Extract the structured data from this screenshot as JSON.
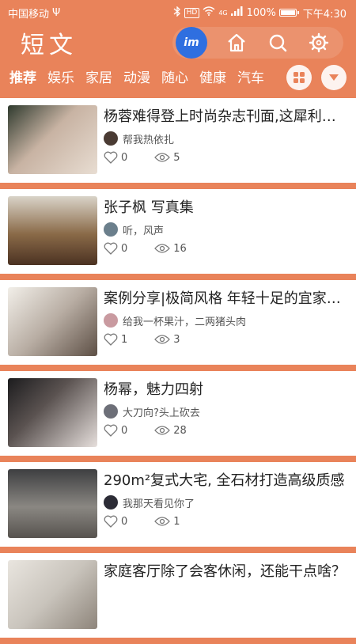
{
  "status_bar": {
    "carrier": "中国移动",
    "usb": "Ψ",
    "hd_tag": "HD",
    "network": "4G",
    "battery": "100%",
    "time": "下午4:30"
  },
  "header": {
    "logo": "短文",
    "app_badge": "im"
  },
  "tabs": [
    "推荐",
    "娱乐",
    "家居",
    "动漫",
    "随心",
    "健康",
    "汽车"
  ],
  "active_tab": 0,
  "articles": [
    {
      "title": "杨蓉难得登上时尚杂志刊面,这犀利眼神...",
      "author": "帮我热依扎",
      "likes": "0",
      "views": "5",
      "thumb": "#b9a79a",
      "avatar": "#4a3b33"
    },
    {
      "title": "张子枫 写真集",
      "author": "听，风声",
      "likes": "0",
      "views": "16",
      "thumb": "#8a6a48",
      "avatar": "#6b7f8c"
    },
    {
      "title": "案例分享|极简风格 年轻十足的宜家设计",
      "author": "给我一杯果汁，二两猪头肉",
      "likes": "1",
      "views": "3",
      "thumb": "#9c8e84",
      "avatar": "#c99aa0"
    },
    {
      "title": "杨幂，魅力四射",
      "author": "大刀向?头上砍去",
      "likes": "0",
      "views": "28",
      "thumb": "#3e3a3a",
      "avatar": "#6d6f78"
    },
    {
      "title": "290m²复式大宅, 全石材打造高级质感",
      "author": "我那天看见你了",
      "likes": "0",
      "views": "1",
      "thumb": "#76736e",
      "avatar": "#2c2c36"
    },
    {
      "title": "家庭客厅除了会客休闲，还能干点啥？",
      "author": "",
      "likes": "",
      "views": "",
      "thumb": "#c9c4bc",
      "avatar": "#999"
    }
  ]
}
